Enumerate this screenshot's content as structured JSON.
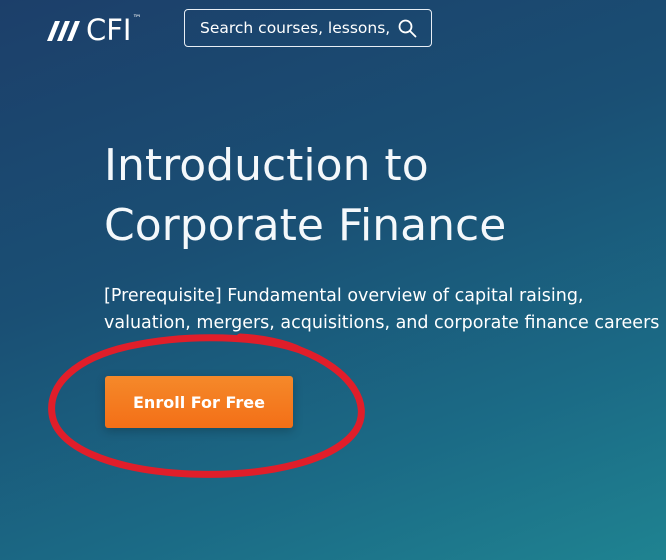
{
  "header": {
    "logo": {
      "icon": "cfi-slashes-logo-icon",
      "text": "CFI",
      "tm": "™"
    },
    "search": {
      "placeholder": "Search courses, lessons,",
      "icon": "search-icon"
    }
  },
  "hero": {
    "title_line1": "Introduction to",
    "title_line2": "Corporate Finance",
    "description": "[Prerequisite] Fundamental overview of capital raising, valuation, mergers, acquisitions, and corporate finance careers",
    "enroll_label": "Enroll For Free"
  },
  "colors": {
    "background_top": "#1c3f6a",
    "background_bottom": "#1f8391",
    "button_orange": "#f37a1f",
    "annotation_red": "#e01e2a"
  }
}
